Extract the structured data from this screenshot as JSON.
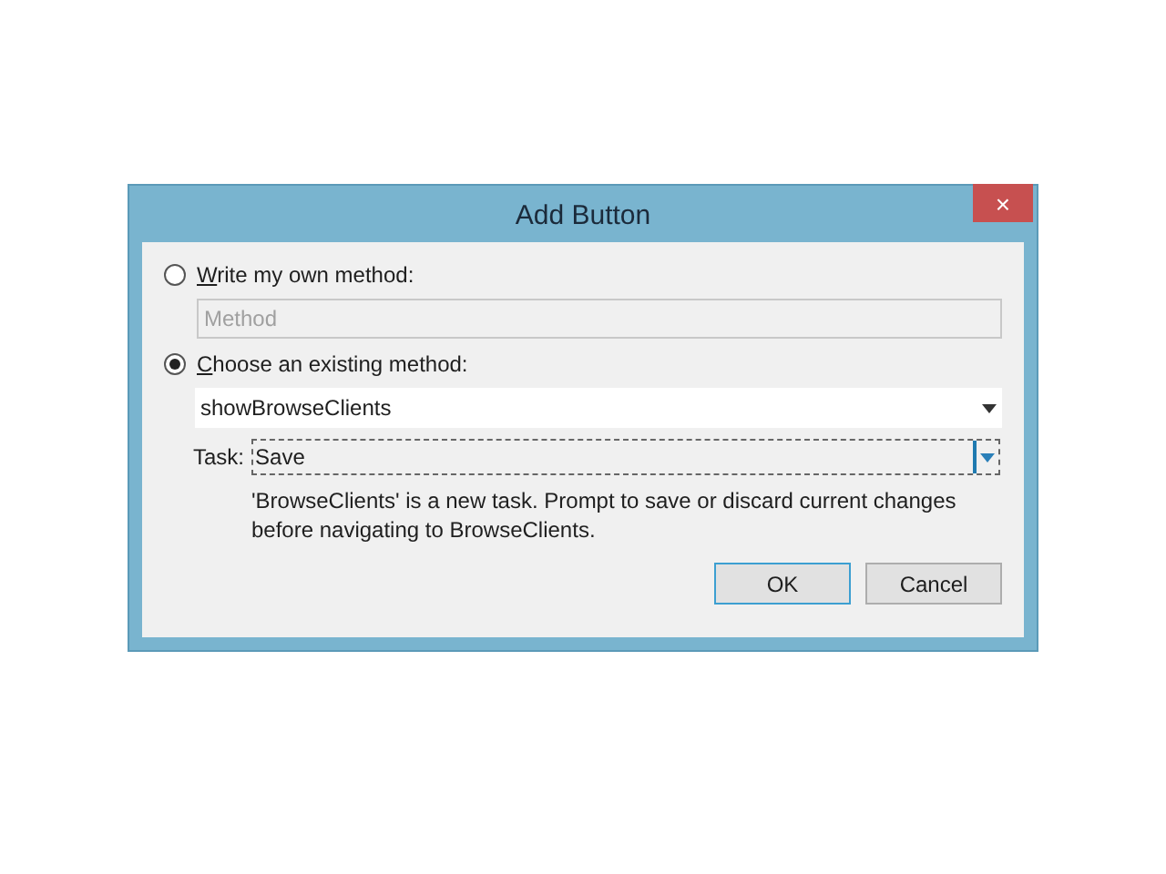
{
  "window": {
    "title": "Add Button",
    "close": "×"
  },
  "options": [
    {
      "label": "Write my own method:",
      "selected": false,
      "kind": "text",
      "field": {
        "placeholder": "Method",
        "disabled": true
      }
    },
    {
      "label": "Choose an existing method:",
      "selected": true,
      "kind": "dropdown",
      "field": {
        "value": "showBrowseClients"
      }
    }
  ],
  "task": {
    "label": "Task:",
    "value": "Save"
  },
  "message": "'BrowseClients' is a new task. Prompt to save or discard current changes before navigating to BrowseClients.",
  "buttons": [
    {
      "label": "OK",
      "default": true
    },
    {
      "label": "Cancel",
      "default": false
    }
  ]
}
